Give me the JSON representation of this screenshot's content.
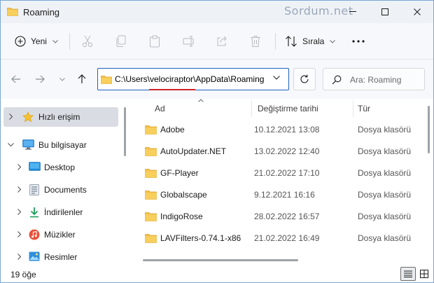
{
  "window": {
    "title": "Roaming",
    "watermark": "Sordum.net",
    "folder_color": "#f4c04a"
  },
  "commandbar": {
    "new_label": "Yeni",
    "sort_label": "Sırala",
    "icons": [
      "cut-icon",
      "copy-icon",
      "paste-icon",
      "rename-icon",
      "share-icon",
      "delete-icon",
      "more-icon"
    ]
  },
  "address": {
    "path": "C:\\Users\\velociraptor\\AppData\\Roaming",
    "search_placeholder": "Ara: Roaming",
    "highlight_color": "#d0242b",
    "focus_color": "#1f5fbf"
  },
  "navpane": {
    "items": [
      {
        "label": "Hızlı erişim",
        "icon": "star-icon",
        "selected": true
      },
      {
        "label": "Bu bilgisayar",
        "icon": "computer-icon",
        "expanded": true
      },
      {
        "label": "Desktop",
        "icon": "desktop-icon"
      },
      {
        "label": "Documents",
        "icon": "documents-icon"
      },
      {
        "label": "İndirilenler",
        "icon": "download-icon"
      },
      {
        "label": "Müzikler",
        "icon": "music-icon"
      },
      {
        "label": "Resimler",
        "icon": "pictures-icon"
      }
    ]
  },
  "filelist": {
    "columns": {
      "name": "Ad",
      "date": "Değiştirme tarihi",
      "type": "Tür"
    },
    "rows": [
      {
        "name": "Adobe",
        "date": "10.12.2021 13:08",
        "type": "Dosya klasörü"
      },
      {
        "name": "AutoUpdater.NET",
        "date": "13.02.2022 12:40",
        "type": "Dosya klasörü"
      },
      {
        "name": "GF-Player",
        "date": "21.02.2022 17:10",
        "type": "Dosya klasörü"
      },
      {
        "name": "Globalscape",
        "date": "9.12.2021 16:16",
        "type": "Dosya klasörü"
      },
      {
        "name": "IndigoRose",
        "date": "28.02.2022 16:57",
        "type": "Dosya klasörü"
      },
      {
        "name": "LAVFilters-0.74.1-x86",
        "date": "21.02.2022 16:49",
        "type": "Dosya klasörü"
      }
    ]
  },
  "status": {
    "item_count": "19 öğe"
  }
}
